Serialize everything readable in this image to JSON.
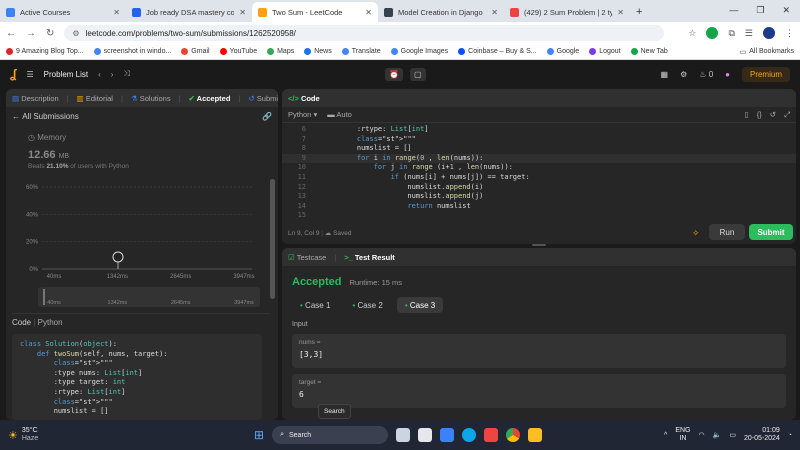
{
  "browser": {
    "tabs": [
      {
        "title": "Active Courses",
        "color": "#3b82f6"
      },
      {
        "title": "Job ready DSA mastery course",
        "color": "#2563eb"
      },
      {
        "title": "Two Sum - LeetCode",
        "color": "#ffa116"
      },
      {
        "title": "Model Creation in Django",
        "color": "#374151"
      },
      {
        "title": "(429) 2 Sum Problem | 2 types",
        "color": "#ef4444"
      }
    ],
    "url": "leetcode.com/problems/two-sum/submissions/1262520958/",
    "bookmarks": [
      "9 Amazing Blog Top...",
      "screenshot in windo...",
      "Gmail",
      "YouTube",
      "Maps",
      "News",
      "Translate",
      "Google Images",
      "Coinbase – Buy & S...",
      "Google",
      "Logout",
      "New Tab"
    ],
    "all_bookmarks": "All Bookmarks"
  },
  "lc": {
    "problem_list": "Problem List",
    "streak": "0",
    "premium": "Premium"
  },
  "left": {
    "tabs": [
      "Description",
      "Editorial",
      "Solutions",
      "Accepted",
      "Submissions"
    ],
    "all_submissions": "All Submissions",
    "memory_label": "Memory",
    "memory_value": "12.66",
    "memory_unit": "MB",
    "beats_prefix": "Beats",
    "beats_pct": "21.10%",
    "beats_suffix": "of users with Python",
    "code_label": "Code",
    "lang": "Python"
  },
  "chart_data": {
    "type": "bar",
    "y_ticks": [
      "60%",
      "40%",
      "20%",
      "0%"
    ],
    "x_ticks": [
      "40ms",
      "1342ms",
      "2645ms",
      "3947ms"
    ],
    "marker_icon": "user-avatar",
    "grid": true
  },
  "editor": {
    "title": "Code",
    "lang": "Python",
    "auto": "Auto",
    "line_start": 6,
    "lines": [
      "    :rtype: List[int]",
      "    \"\"\"",
      "    numslist = []",
      "    for i in range(0 , len(nums)):",
      "        for j in range (i+1 , len(nums)):",
      "            if (nums[i] + nums[j]) == target:",
      "                numslist.append(i)",
      "                numslist.append(j)",
      "                return numslist",
      ""
    ],
    "status": "Ln 9, Col 9",
    "saved": "Saved",
    "run": "Run",
    "submit": "Submit"
  },
  "result": {
    "tabs": [
      "Testcase",
      "Test Result"
    ],
    "status": "Accepted",
    "runtime": "Runtime: 15 ms",
    "cases": [
      "Case 1",
      "Case 2",
      "Case 3"
    ],
    "input_label": "Input",
    "params": [
      {
        "name": "nums =",
        "value": "[3,3]"
      },
      {
        "name": "target =",
        "value": "6"
      }
    ]
  },
  "submission_code": [
    "class Solution(object):",
    "    def twoSum(self, nums, target):",
    "        \"\"\"",
    "        :type nums: List[int]",
    "        :type target: int",
    "        :rtype: List[int]",
    "        \"\"\"",
    "        numslist = []"
  ],
  "tooltip": "Search",
  "taskbar": {
    "temp": "35°C",
    "weather": "Haze",
    "search": "Search",
    "lang1": "ENG",
    "lang2": "IN",
    "time": "01:09",
    "date": "20-05-2024"
  }
}
